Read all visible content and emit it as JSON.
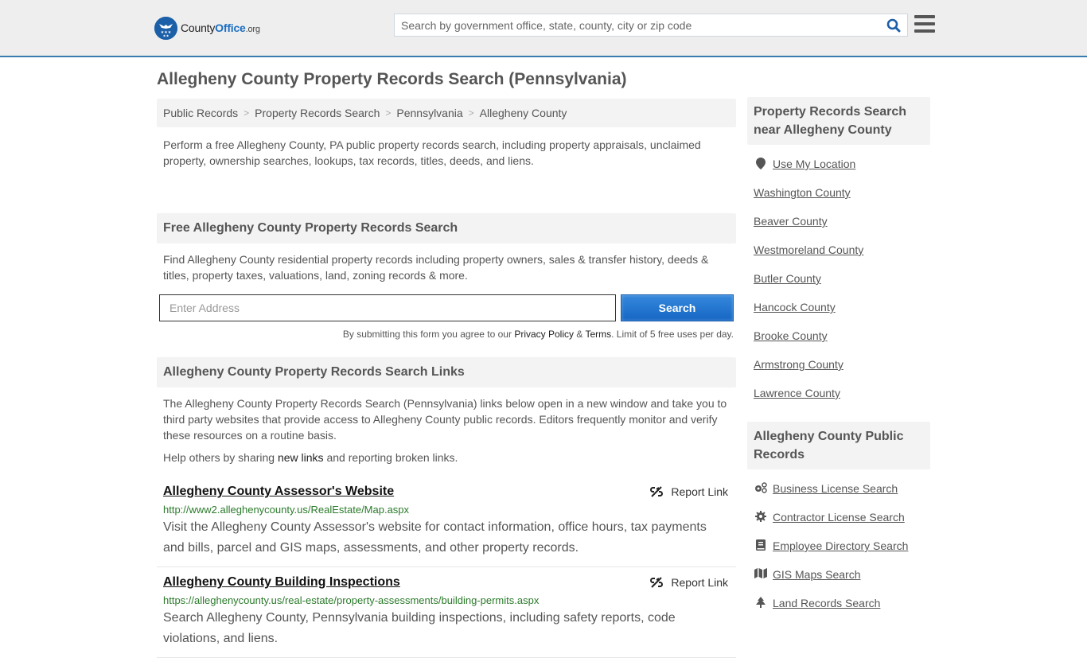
{
  "header": {
    "logo": {
      "name_part1": "County",
      "name_part2": "Office",
      "name_part3": ".org"
    },
    "search": {
      "placeholder": "Search by government office, state, county, city or zip code",
      "value": ""
    },
    "icons": {
      "search": "search-icon",
      "menu": "hamburger-menu-icon"
    }
  },
  "page": {
    "title": "Allegheny County Property Records Search (Pennsylvania)",
    "breadcrumb": [
      {
        "label": "Public Records"
      },
      {
        "label": "Property Records Search"
      },
      {
        "label": "Pennsylvania"
      },
      {
        "label": "Allegheny County"
      }
    ],
    "breadcrumb_separator": ">",
    "intro": "Perform a free Allegheny County, PA public property records search, including property appraisals, unclaimed property, ownership searches, lookups, tax records, titles, deeds, and liens."
  },
  "free_search": {
    "heading": "Free Allegheny County Property Records Search",
    "text": "Find Allegheny County residential property records including property owners, sales & transfer history, deeds & titles, property taxes, valuations, land, zoning records & more.",
    "address_placeholder": "Enter Address",
    "address_value": "",
    "button_label": "Search",
    "disclaimer_prefix": "By submitting this form you agree to our ",
    "privacy_label": "Privacy Policy",
    "amp": " & ",
    "terms_label": "Terms",
    "disclaimer_suffix": ". Limit of 5 free uses per day."
  },
  "links_section": {
    "heading": "Allegheny County Property Records Search Links",
    "text": "The Allegheny County Property Records Search (Pennsylvania) links below open in a new window and take you to third party websites that provide access to Allegheny County public records. Editors frequently monitor and verify these resources on a routine basis.",
    "help_prefix": "Help others by sharing ",
    "help_link": "new links",
    "help_suffix": " and reporting broken links.",
    "report_label": "Report Link",
    "items": [
      {
        "title": "Allegheny County Assessor's Website",
        "url": "http://www2.alleghenycounty.us/RealEstate/Map.aspx",
        "description": "Visit the Allegheny County Assessor's website for contact information, office hours, tax payments and bills, parcel and GIS maps, assessments, and other property records."
      },
      {
        "title": "Allegheny County Building Inspections",
        "url": "https://alleghenycounty.us/real-estate/property-assessments/building-permits.aspx",
        "description": "Search Allegheny County, Pennsylvania building inspections, including safety reports, code violations, and liens."
      }
    ]
  },
  "sidebar": {
    "nearby": {
      "heading": "Property Records Search near Allegheny County",
      "use_location": "Use My Location",
      "counties": [
        "Washington County",
        "Beaver County",
        "Westmoreland County",
        "Butler County",
        "Hancock County",
        "Brooke County",
        "Armstrong County",
        "Lawrence County"
      ]
    },
    "public_records": {
      "heading": "Allegheny County Public Records",
      "items": [
        {
          "label": "Business License Search",
          "icon": "cogs-icon"
        },
        {
          "label": "Contractor License Search",
          "icon": "gear-icon"
        },
        {
          "label": "Employee Directory Search",
          "icon": "book-icon"
        },
        {
          "label": "GIS Maps Search",
          "icon": "map-icon"
        },
        {
          "label": "Land Records Search",
          "icon": "tree-icon"
        }
      ]
    }
  },
  "colors": {
    "brand_blue": "#1b6ec2",
    "header_border": "#3a7bb0",
    "url_green": "#2a7a2a",
    "button_blue": "#1566c4"
  }
}
